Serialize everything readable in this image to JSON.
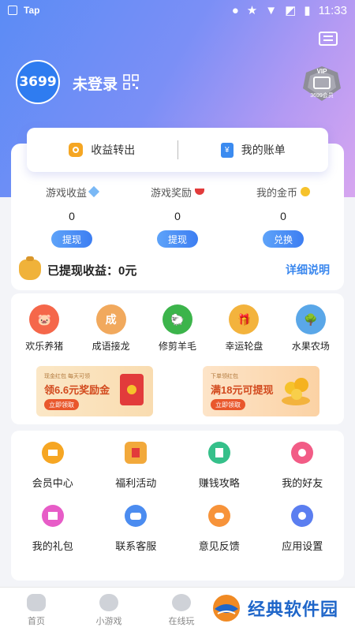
{
  "status_bar": {
    "app_label": "Tap",
    "time": "11:33"
  },
  "header": {
    "avatar_text": "3699",
    "username": "未登录",
    "vip_label": "3699会员",
    "vip_badge_text": "VIP"
  },
  "transfer": {
    "left_label": "收益转出",
    "right_label": "我的账单"
  },
  "stats": [
    {
      "title": "游戏收益",
      "value": "0",
      "button": "提现"
    },
    {
      "title": "游戏奖励",
      "value": "0",
      "button": "提现"
    },
    {
      "title": "我的金币",
      "value": "0",
      "button": "兑换"
    }
  ],
  "withdrawn": {
    "text": "已提现收益：0元",
    "detail_link": "详细说明"
  },
  "games": [
    {
      "label": "欢乐养猪",
      "color": "#f5674a",
      "icon": "pig-icon"
    },
    {
      "label": "成语接龙",
      "color": "#f1a95d",
      "icon": "idiom-icon"
    },
    {
      "label": "修剪羊毛",
      "color": "#3cb44b",
      "icon": "sheep-icon"
    },
    {
      "label": "幸运轮盘",
      "color": "#f3b33d",
      "icon": "gift-icon"
    },
    {
      "label": "水果农场",
      "color": "#5aa7e8",
      "icon": "tree-icon"
    }
  ],
  "promos": [
    {
      "small": "现金红包 每天可领",
      "main": "领6.6元奖励金",
      "button": "立即领取"
    },
    {
      "small": "下单领红包",
      "main": "满18元可提现",
      "button": "立即领取"
    }
  ],
  "tools": [
    {
      "label": "会员中心",
      "color": "#f6a623",
      "icon": "crown-icon"
    },
    {
      "label": "福利活动",
      "color": "#f2a93b",
      "icon": "welfare-icon"
    },
    {
      "label": "赚钱攻略",
      "color": "#35c08a",
      "icon": "guide-icon"
    },
    {
      "label": "我的好友",
      "color": "#f25c86",
      "icon": "friend-icon"
    },
    {
      "label": "我的礼包",
      "color": "#e75cc7",
      "icon": "giftbox-icon"
    },
    {
      "label": "联系客服",
      "color": "#4b8cf0",
      "icon": "service-icon"
    },
    {
      "label": "意见反馈",
      "color": "#f7933a",
      "icon": "feedback-icon"
    },
    {
      "label": "应用设置",
      "color": "#5b7ef0",
      "icon": "settings-icon"
    }
  ],
  "bottom_nav": [
    {
      "label": "首页"
    },
    {
      "label": "小游戏"
    },
    {
      "label": "在线玩"
    }
  ],
  "watermark": {
    "text": "经典软件园"
  }
}
